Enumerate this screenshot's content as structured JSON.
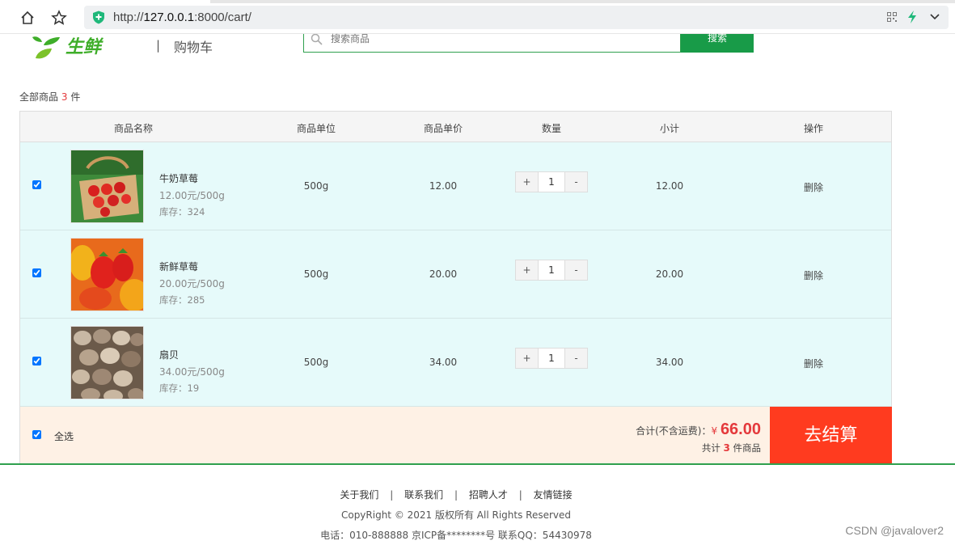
{
  "browser": {
    "url_host": "http://",
    "url_bold": "127.0.0.1",
    "url_rest": ":8000/cart/"
  },
  "header": {
    "logo_text": "生鲜",
    "divider": "|",
    "title": "购物车",
    "search_placeholder": "搜索商品",
    "search_button": "搜索"
  },
  "summary": {
    "prefix": "全部商品",
    "count": "3",
    "suffix": "件"
  },
  "table": {
    "headers": [
      "商品名称",
      "商品单位",
      "商品单价",
      "数量",
      "小计",
      "操作"
    ],
    "rows": [
      {
        "name": "牛奶草莓",
        "price_unit": "12.00元/500g",
        "stock": "库存：324",
        "unit": "500g",
        "price": "12.00",
        "qty": "1",
        "subtotal": "12.00",
        "action": "删除",
        "checked": true
      },
      {
        "name": "新鲜草莓",
        "price_unit": "20.00元/500g",
        "stock": "库存：285",
        "unit": "500g",
        "price": "20.00",
        "qty": "1",
        "subtotal": "20.00",
        "action": "删除",
        "checked": true
      },
      {
        "name": "扇贝",
        "price_unit": "34.00元/500g",
        "stock": "库存：19",
        "unit": "500g",
        "price": "34.00",
        "qty": "1",
        "subtotal": "34.00",
        "action": "删除",
        "checked": true
      }
    ],
    "qty_plus": "+",
    "qty_minus": "-"
  },
  "footer_bar": {
    "select_all": "全选",
    "total_label": "合计(不含运费)：",
    "currency": "¥",
    "total_value": "66.00",
    "count_prefix": "共计",
    "count": "3",
    "count_suffix": "件商品",
    "checkout": "去结算"
  },
  "site_footer": {
    "links": [
      "关于我们",
      "联系我们",
      "招聘人才",
      "友情链接"
    ],
    "separator": "|",
    "copyright": "CopyRight © 2021 版权所有 All Rights Reserved",
    "contact": "电话：010-888888 京ICP备********号 联系QQ：54430978"
  },
  "watermark": "CSDN @javalover2",
  "colors": {
    "brand_green": "#189b48",
    "accent_red": "#e4393c",
    "checkout_red": "#ff3b1f",
    "row_bg": "#e6fafa",
    "footer_bar_bg": "#fef1e5"
  }
}
